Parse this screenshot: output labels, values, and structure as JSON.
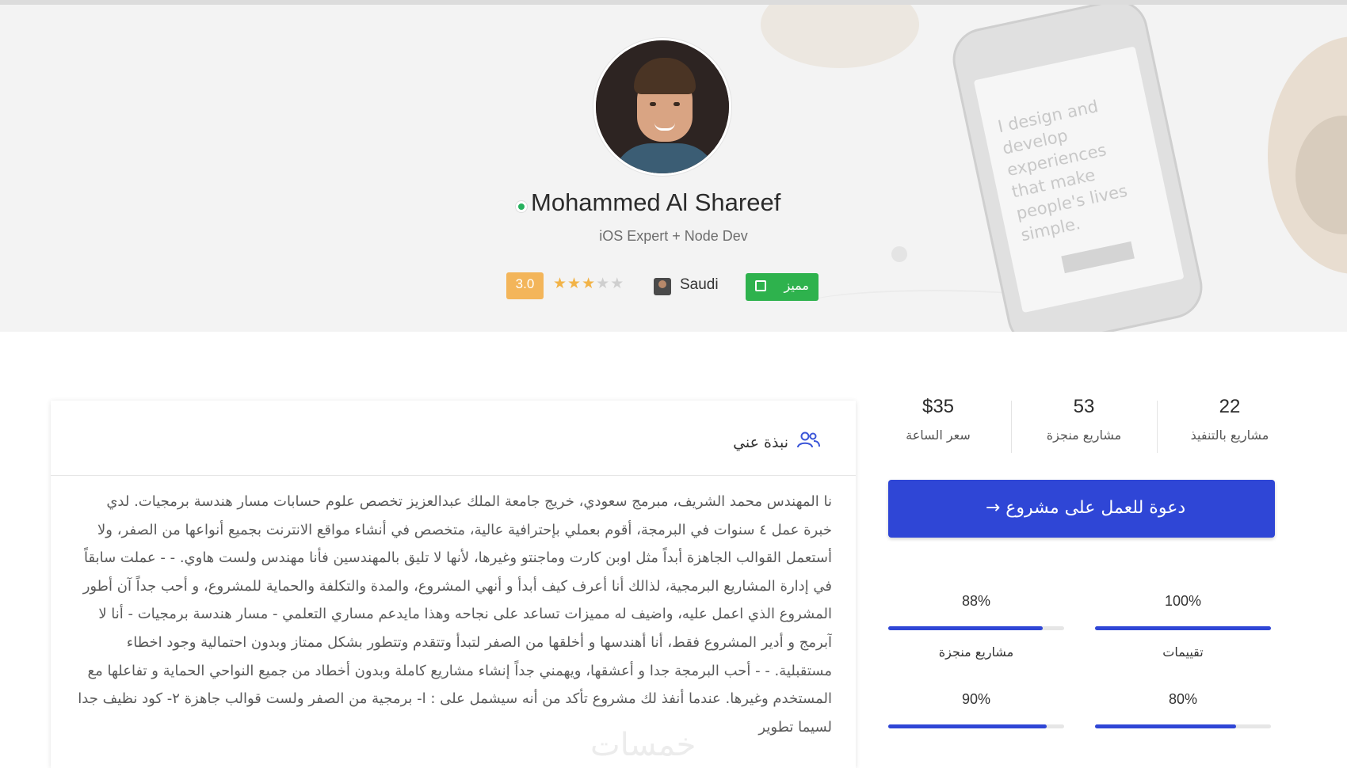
{
  "profile": {
    "name": "Mohammed Al Shareef",
    "subtitle": "iOS Expert + Node Dev",
    "rating": "3.0",
    "stars_filled": 3,
    "stars_total": 5,
    "country": "Saudi",
    "featured_label": "مميز",
    "online": true
  },
  "hero": {
    "phone_text": "I design and develop experiences that make people's lives simple."
  },
  "about": {
    "title": "نبذة عني",
    "body": "نا المهندس محمد الشريف، مبرمج سعودي، خريج جامعة الملك عبدالعزيز تخصص علوم حسابات مسار هندسة برمجيات. لدي خبرة عمل ٤ سنوات في البرمجة، أقوم بعملي بإحترافية عالية، متخصص في أنشاء مواقع الانترنت بجميع أنواعها من الصفر، ولا أستعمل القوالب الجاهزة أبداً مثل اوبن كارت وماجنتو وغيرها، لأنها لا تليق بالمهندسين فأنا مهندس ولست هاوي. - - عملت سابقاً في إدارة المشاريع البرمجية، لذالك أنا أعرف كيف أبدأ و أنهي المشروع، والمدة والتكلفة والحماية للمشروع، و أحب جداً آن أطور المشروع الذي اعمل عليه، واضيف له مميزات تساعد على نجاحه وهذا مايدعم مساري التعلمي - مسار هندسة برمجيات - أنا لا آبرمج و أدير المشروع فقط، أنا أهندسها و أخلقها من الصفر لتبدأ وتتقدم وتتطور بشكل ممتاز وبدون احتمالية وجود اخطاء مستقبلية. - - أحب البرمجة جدا و أعشقها، ويهمني جداً إنشاء مشاريع كاملة وبدون أخطاد من جميع النواحي الحماية و تفاعلها مع المستخدم وغيرها. عندما أنفذ لك مشروع تأكد من أنه سيشمل على : ا- برمجية من الصفر ولست قوالب جاهزة ٢- كود نظيف جدا لسيما تطوير"
  },
  "stats": [
    {
      "value": "22",
      "label": "مشاريع بالتنفيذ"
    },
    {
      "value": "53",
      "label": "مشاريع منجزة"
    },
    {
      "value": "$35",
      "label": "سعر الساعة"
    }
  ],
  "invite_button": {
    "label": "دعوة للعمل على مشروع",
    "arrow": "→"
  },
  "metrics": [
    {
      "percent": "100%",
      "fill": 1.0,
      "label": "تقييمات"
    },
    {
      "percent": "88%",
      "fill": 0.88,
      "label": "مشاريع منجزة"
    },
    {
      "percent": "80%",
      "fill": 0.8,
      "label": ""
    },
    {
      "percent": "90%",
      "fill": 0.9,
      "label": ""
    }
  ],
  "watermark": "خمسات",
  "colors": {
    "accent": "#2f46d6",
    "featured": "#2eb24d",
    "rating": "#f3b55a",
    "online": "#27b15e"
  }
}
